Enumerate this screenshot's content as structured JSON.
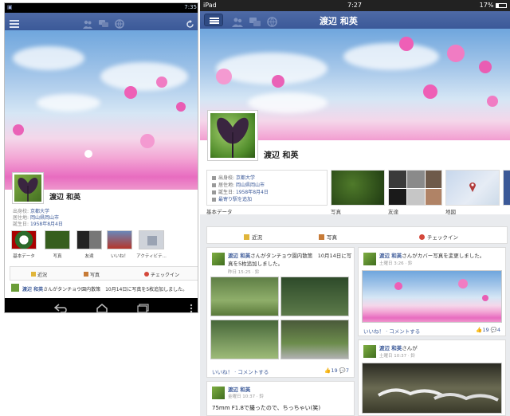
{
  "phone": {
    "status": {
      "time": "7:35"
    },
    "profile": {
      "name": "渡辺 和英",
      "info": [
        {
          "key": "出身校:",
          "value": "京都大学"
        },
        {
          "key": "居住地:",
          "value": "岡山県岡山市"
        },
        {
          "key": "誕生日:",
          "value": "1958年8月4日"
        }
      ]
    },
    "tiles": [
      "基本データ",
      "写真",
      "友達",
      "いいね！",
      "アクティビテ..."
    ],
    "actions": [
      "近況",
      "写真",
      "チェックイン"
    ],
    "post_preview": {
      "name": "渡辺 和英",
      "text": "さんがタンチョウ園内散策　10月14日に写真を5枚追加しました。"
    }
  },
  "tablet": {
    "status": {
      "left": "iPad",
      "time": "7:27",
      "battery": "17%"
    },
    "title": "渡辺 和英",
    "profile": {
      "name": "渡辺 和英",
      "about": [
        {
          "key": "出身校:",
          "value": "京都大学"
        },
        {
          "key": "居住地:",
          "value": "岡山県岡山市"
        },
        {
          "key": "誕生日:",
          "value": "1958年8月4日"
        },
        {
          "key": "",
          "value": "最寄り駅を追加"
        }
      ],
      "about_label": "基本データ"
    },
    "tiles": [
      "写真",
      "友達",
      "地図"
    ],
    "actions": [
      "近況",
      "写真",
      "チェックイン"
    ],
    "posts": [
      {
        "name": "渡辺 和英",
        "text": "さんがタンチョウ園内散策　10月14日に写真を5枚追加しました。",
        "time": "昨日 15:25 · 鈴",
        "like": "いいね！",
        "comment": "コメントする",
        "likes": "19",
        "comments": "7"
      },
      {
        "name": "渡辺 和英",
        "text": "さんがカバー写真を変更しました。",
        "time": "土曜日 3:26 · 鈴",
        "like": "いいね！",
        "comment": "コメントする",
        "likes": "19",
        "comments": "4"
      },
      {
        "name": "渡辺 和英",
        "text": "さんが",
        "time": "土曜日 10:37 · 鈴"
      },
      {
        "name": "渡辺 和英",
        "text": "75mm F1.8で撮ったので、ちっちゃい(笑)",
        "time": "金曜日 10:37 · 鈴"
      }
    ]
  },
  "colors": {
    "facebook_blue": "#3b5998",
    "status_bar": "#222222"
  }
}
